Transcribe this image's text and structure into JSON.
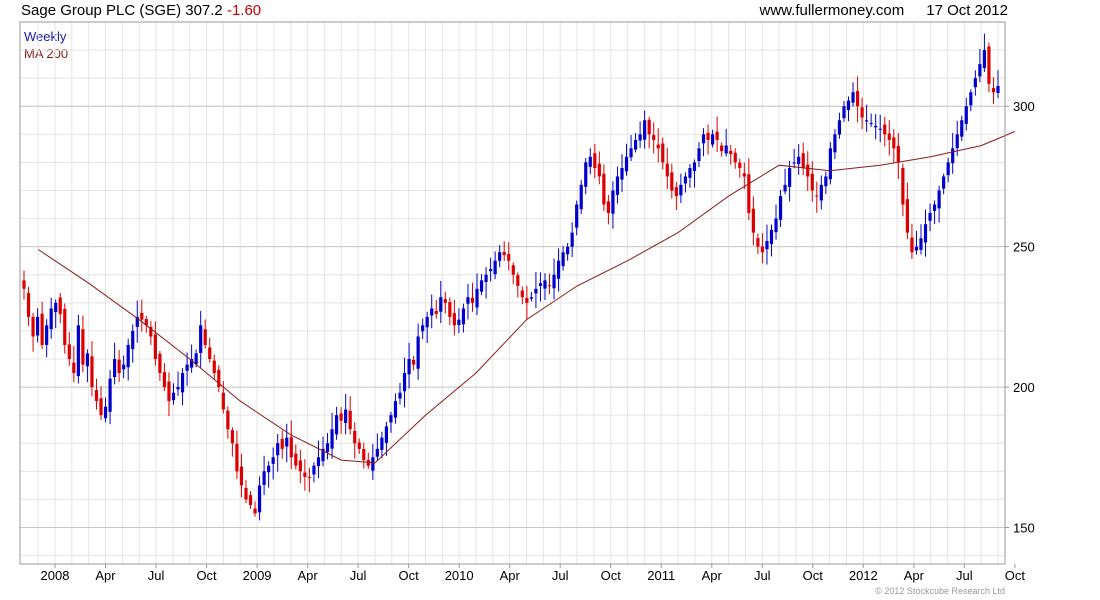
{
  "header": {
    "title": "Sage Group PLC (SGE) 307.2",
    "change": "-1.60",
    "website": "www.fullermoney.com",
    "date": "17 Oct 2012"
  },
  "footer": {
    "copyright": "© 2012 Stockcube Research Ltd"
  },
  "colors": {
    "up": "#0000cc",
    "down": "#dd0000",
    "ma": "#8b1a1a",
    "grid": "#e4e4e4"
  },
  "chart_data": {
    "type": "candlestick",
    "title": "Sage Group PLC (SGE) 307.2 -1.60",
    "interval_label": "Weekly",
    "grid": true,
    "y_axis_position": "right",
    "ylim": [
      137,
      330
    ],
    "y_ticks": [
      150,
      200,
      250,
      300
    ],
    "x_ticks": [
      "2008",
      "Apr",
      "Jul",
      "Oct",
      "2009",
      "Apr",
      "Jul",
      "Oct",
      "2010",
      "Apr",
      "Jul",
      "Oct",
      "2011",
      "Apr",
      "Jul",
      "Oct",
      "2012",
      "Apr",
      "Jul",
      "Oct"
    ],
    "series": [
      {
        "name": "Weekly",
        "type": "candlestick",
        "approx_closes": [
          235,
          225,
          218,
          225,
          215,
          222,
          228,
          230,
          226,
          215,
          210,
          205,
          222,
          208,
          212,
          200,
          195,
          190,
          193,
          203,
          210,
          205,
          208,
          215,
          220,
          225,
          224,
          222,
          218,
          210,
          205,
          200,
          195,
          198,
          200,
          205,
          208,
          210,
          212,
          222,
          215,
          210,
          205,
          200,
          192,
          185,
          180,
          170,
          165,
          160,
          158,
          155,
          165,
          170,
          172,
          175,
          180,
          178,
          182,
          175,
          172,
          170,
          168,
          168,
          172,
          175,
          178,
          180,
          185,
          190,
          188,
          192,
          185,
          180,
          178,
          174,
          172,
          175,
          178,
          182,
          186,
          190,
          195,
          198,
          205,
          210,
          208,
          218,
          222,
          225,
          228,
          226,
          232,
          230,
          225,
          222,
          224,
          228,
          232,
          230,
          235,
          238,
          240,
          242,
          245,
          248,
          247,
          245,
          240,
          236,
          232,
          230,
          232,
          235,
          237,
          238,
          236,
          240,
          245,
          248,
          250,
          255,
          265,
          272,
          280,
          282,
          278,
          275,
          265,
          262,
          270,
          275,
          278,
          282,
          285,
          288,
          290,
          295,
          290,
          288,
          285,
          280,
          275,
          270,
          268,
          272,
          275,
          278,
          280,
          285,
          290,
          288,
          290,
          288,
          284,
          286,
          283,
          280,
          278,
          275,
          262,
          255,
          250,
          248,
          252,
          256,
          260,
          268,
          272,
          278,
          280,
          282,
          278,
          275,
          270,
          268,
          272,
          275,
          285,
          290,
          295,
          300,
          302,
          305,
          300,
          296,
          295,
          294,
          293,
          292,
          290,
          288,
          285,
          280,
          265,
          255,
          248,
          250,
          253,
          258,
          262,
          265,
          270,
          275,
          280,
          285,
          290,
          295,
          300,
          305,
          310,
          315,
          320,
          308,
          305,
          307.2
        ]
      },
      {
        "name": "MA 200",
        "type": "line",
        "points": [
          {
            "x": "Dec 2007",
            "y": 249
          },
          {
            "x": "Mar 2008",
            "y": 237
          },
          {
            "x": "Jun 2008",
            "y": 224
          },
          {
            "x": "Sep 2008",
            "y": 210
          },
          {
            "x": "Dec 2008",
            "y": 195
          },
          {
            "x": "Mar 2009",
            "y": 183
          },
          {
            "x": "Jun 2009",
            "y": 174
          },
          {
            "x": "Aug 2009",
            "y": 173
          },
          {
            "x": "Nov 2009",
            "y": 190
          },
          {
            "x": "Feb 2010",
            "y": 205
          },
          {
            "x": "May 2010",
            "y": 224
          },
          {
            "x": "Aug 2010",
            "y": 236
          },
          {
            "x": "Nov 2010",
            "y": 245
          },
          {
            "x": "Feb 2011",
            "y": 255
          },
          {
            "x": "May 2011",
            "y": 268
          },
          {
            "x": "Aug 2011",
            "y": 279
          },
          {
            "x": "Nov 2011",
            "y": 277
          },
          {
            "x": "Feb 2012",
            "y": 279
          },
          {
            "x": "May 2012",
            "y": 282
          },
          {
            "x": "Aug 2012",
            "y": 286
          },
          {
            "x": "Oct 2012",
            "y": 291
          }
        ]
      }
    ]
  }
}
